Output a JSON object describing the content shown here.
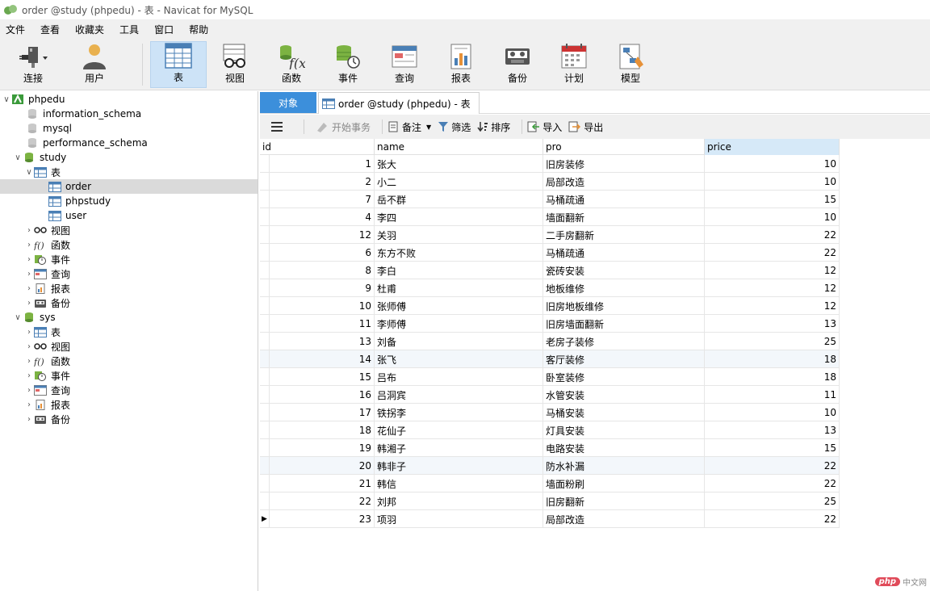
{
  "window": {
    "title": "order @study (phpedu) - 表 - Navicat for MySQL"
  },
  "menu": [
    "文件",
    "查看",
    "收藏夹",
    "工具",
    "窗口",
    "帮助"
  ],
  "toolbar": {
    "connect": "连接",
    "user": "用户",
    "table": "表",
    "view": "视图",
    "function": "函数",
    "event": "事件",
    "query": "查询",
    "report": "报表",
    "backup": "备份",
    "schedule": "计划",
    "model": "模型"
  },
  "sidebar": {
    "connection": "phpedu",
    "databases": [
      "information_schema",
      "mysql",
      "performance_schema"
    ],
    "study": {
      "name": "study",
      "tables_label": "表",
      "tables": [
        "order",
        "phpstudy",
        "user"
      ],
      "groups": [
        "视图",
        "函数",
        "事件",
        "查询",
        "报表",
        "备份"
      ]
    },
    "sys": {
      "name": "sys",
      "groups": [
        "表",
        "视图",
        "函数",
        "事件",
        "查询",
        "报表",
        "备份"
      ]
    }
  },
  "tabs": {
    "objects": "对象",
    "order": "order @study (phpedu) - 表"
  },
  "subtoolbar": {
    "begin_transaction": "开始事务",
    "note": "备注",
    "filter": "筛选",
    "sort": "排序",
    "import": "导入",
    "export": "导出"
  },
  "grid": {
    "columns": [
      "id",
      "name",
      "pro",
      "price"
    ],
    "rows": [
      [
        "1",
        "张大",
        "旧房装修",
        "10"
      ],
      [
        "2",
        "小二",
        "局部改造",
        "10"
      ],
      [
        "7",
        "岳不群",
        "马桶疏通",
        "15"
      ],
      [
        "4",
        "李四",
        "墙面翻新",
        "10"
      ],
      [
        "12",
        "关羽",
        "二手房翻新",
        "22"
      ],
      [
        "6",
        "东方不败",
        "马桶疏通",
        "22"
      ],
      [
        "8",
        "李白",
        "瓷砖安装",
        "12"
      ],
      [
        "9",
        "杜甫",
        "地板维修",
        "12"
      ],
      [
        "10",
        "张师傅",
        "旧房地板维修",
        "12"
      ],
      [
        "11",
        "李师傅",
        "旧房墙面翻新",
        "13"
      ],
      [
        "13",
        "刘备",
        "老房子装修",
        "25"
      ],
      [
        "14",
        "张飞",
        "客厅装修",
        "18"
      ],
      [
        "15",
        "吕布",
        "卧室装修",
        "18"
      ],
      [
        "16",
        "吕洞宾",
        "水管安装",
        "11"
      ],
      [
        "17",
        "铁拐李",
        "马桶安装",
        "10"
      ],
      [
        "18",
        "花仙子",
        "灯具安装",
        "13"
      ],
      [
        "19",
        "韩湘子",
        "电路安装",
        "15"
      ],
      [
        "20",
        "韩非子",
        "防水补漏",
        "22"
      ],
      [
        "21",
        "韩信",
        "墙面粉刷",
        "22"
      ],
      [
        "22",
        "刘邦",
        "旧房翻新",
        "25"
      ],
      [
        "23",
        "项羽",
        "局部改造",
        "22"
      ]
    ]
  },
  "watermark": {
    "badge": "php",
    "text": "中文网"
  }
}
